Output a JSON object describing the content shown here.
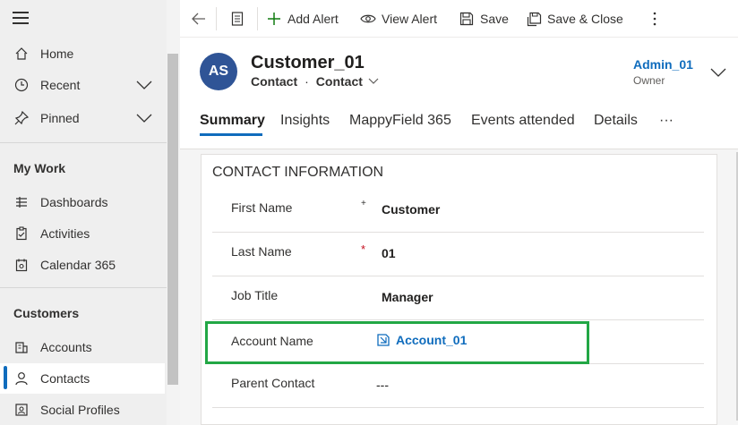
{
  "sidebar": {
    "items_top": [
      {
        "label": "Home",
        "icon": "home-icon"
      },
      {
        "label": "Recent",
        "icon": "clock-icon"
      },
      {
        "label": "Pinned",
        "icon": "pin-icon"
      }
    ],
    "section_mywork": "My Work",
    "items_mywork": [
      {
        "label": "Dashboards",
        "icon": "dashboard-icon"
      },
      {
        "label": "Activities",
        "icon": "clipboard-icon"
      },
      {
        "label": "Calendar 365",
        "icon": "calendar-icon"
      }
    ],
    "section_customers": "Customers",
    "items_customers": [
      {
        "label": "Accounts",
        "icon": "building-icon"
      },
      {
        "label": "Contacts",
        "icon": "person-icon"
      },
      {
        "label": "Social Profiles",
        "icon": "profile-icon"
      }
    ]
  },
  "commandbar": {
    "add_alert": "Add Alert",
    "view_alert": "View Alert",
    "save": "Save",
    "save_close": "Save & Close"
  },
  "header": {
    "avatar_initials": "AS",
    "title": "Customer_01",
    "entity": "Contact",
    "form_selector": "Contact",
    "separator": "·",
    "owner_name": "Admin_01",
    "owner_label": "Owner"
  },
  "tabs": [
    {
      "label": "Summary"
    },
    {
      "label": "Insights"
    },
    {
      "label": "MappyField 365"
    },
    {
      "label": "Events attended"
    },
    {
      "label": "Details"
    },
    {
      "label": "···"
    }
  ],
  "form": {
    "section_title": "CONTACT INFORMATION",
    "fields": [
      {
        "label": "First Name",
        "value": "Customer",
        "required_mark": "+"
      },
      {
        "label": "Last Name",
        "value": "01",
        "required_mark": "*"
      },
      {
        "label": "Job Title",
        "value": "Manager",
        "required_mark": ""
      },
      {
        "label": "Account Name",
        "value": "Account_01",
        "required_mark": ""
      },
      {
        "label": "Parent Contact",
        "value": "---",
        "required_mark": ""
      }
    ]
  },
  "colors": {
    "accent": "#0f6cbd",
    "highlight": "#22a745",
    "required": "#c50f1f",
    "avatar_bg": "#2f5496"
  }
}
